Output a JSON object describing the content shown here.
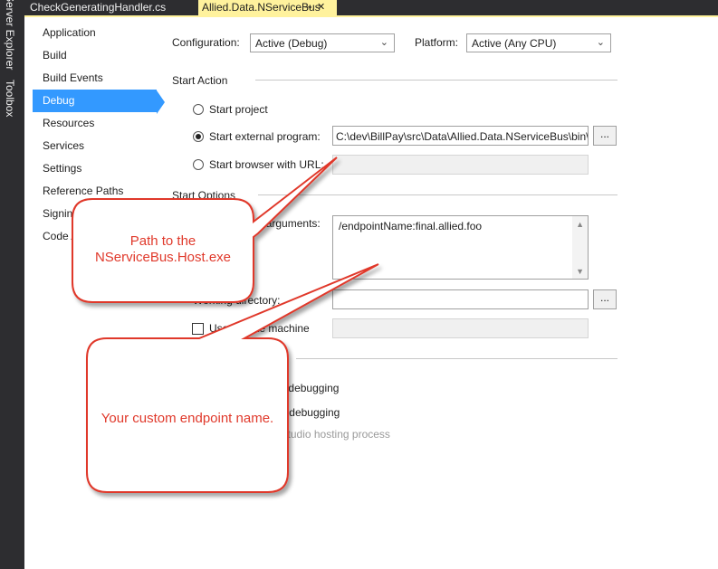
{
  "side_panel": {
    "server_explorer": "Server Explorer",
    "toolbox": "Toolbox"
  },
  "tabs": [
    {
      "label": "CheckGeneratingHandler.cs"
    },
    {
      "label": "Allied.Data.NServiceBus",
      "pin": "⊸",
      "close": "✕"
    }
  ],
  "nav": {
    "items": [
      "Application",
      "Build",
      "Build Events",
      "Debug",
      "Resources",
      "Services",
      "Settings",
      "Reference Paths",
      "Signing",
      "Code Analysis"
    ],
    "selected": "Debug"
  },
  "config": {
    "configuration_label": "Configuration:",
    "configuration_value": "Active (Debug)",
    "platform_label": "Platform:",
    "platform_value": "Active (Any CPU)"
  },
  "start_action": {
    "title": "Start Action",
    "start_project": "Start project",
    "start_external": "Start external program:",
    "external_path": "C:\\dev\\BillPay\\src\\Data\\Allied.Data.NServiceBus\\bin\\",
    "start_browser": "Start browser with URL:",
    "browse_label": "...",
    "selected": "start_external"
  },
  "start_options": {
    "title": "Start Options",
    "cmd_args_label": "Command line arguments:",
    "cmd_args_value": "/endpointName:final.allied.foo",
    "working_dir_label": "Working directory:",
    "working_dir_value": "",
    "browse_label": "...",
    "remote_label": "Use remote machine",
    "remote_checked": false
  },
  "debuggers": {
    "native_label": "Enable native code debugging",
    "sql_label": "Enable SQL Server debugging",
    "hosting_label": "Enable the Visual Studio hosting process"
  },
  "callouts": {
    "path": "Path to the\nNServiceBus.Host.exe",
    "endpoint": "Your custom endpoint name."
  },
  "colors": {
    "accent": "#3399ff",
    "tab_active": "#fff29d",
    "dark_chrome": "#2d2d30",
    "callout_stroke": "#e0392b"
  }
}
